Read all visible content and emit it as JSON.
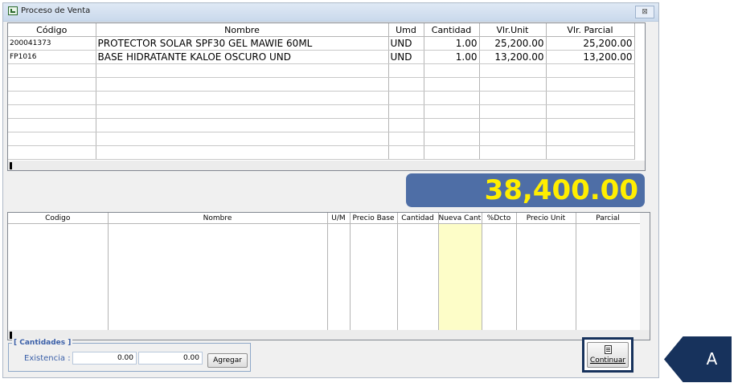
{
  "window": {
    "title": "Proceso de Venta",
    "close_glyph": "⊠"
  },
  "grid1": {
    "headers": [
      "Código",
      "Nombre",
      "Umd",
      "Cantidad",
      "Vlr.Unit",
      "Vlr. Parcial"
    ],
    "rows": [
      [
        "200041373",
        "PROTECTOR SOLAR SPF30 GEL MAWIE 60ML",
        "UND",
        "1.00",
        "25,200.00",
        "25,200.00"
      ],
      [
        "FP1016",
        "BASE HIDRATANTE KALOE OSCURO UND",
        "UND",
        "1.00",
        "13,200.00",
        "13,200.00"
      ]
    ]
  },
  "total": "38,400.00",
  "grid2": {
    "headers": [
      "Codigo",
      "Nombre",
      "U/M",
      "Precio Base",
      "Cantidad",
      "Nueva Cantidad",
      "%Dcto",
      "Precio Unit",
      "Parcial"
    ]
  },
  "cantidades": {
    "title": "[ Cantidades ]",
    "existencia_label": "Existencia :",
    "value1": "0.00",
    "value2": "0.00",
    "agregar_label": "Agregar"
  },
  "continuar_label": "Continuar",
  "callout_label": "A",
  "colors": {
    "total_bg": "#4e6ea6",
    "total_text": "#ffee00",
    "callout": "#17325c",
    "highlight_col": "#fdfdc8"
  }
}
